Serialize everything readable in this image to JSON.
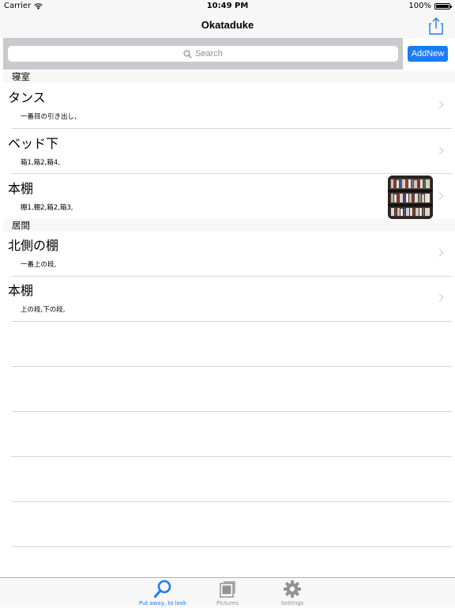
{
  "status": {
    "carrier": "Carrier",
    "time": "10:49 PM",
    "battery": "100%"
  },
  "nav": {
    "title": "Okataduke",
    "share_icon": "share-icon"
  },
  "search": {
    "placeholder": "Search",
    "add_label": "AddNew"
  },
  "sections": [
    {
      "header": "寝室",
      "rows": [
        {
          "title": "タンス",
          "subtitle": "一番目の引き出し,"
        },
        {
          "title": "ベッド下",
          "subtitle": "箱1,箱2,箱4,"
        },
        {
          "title": "本棚",
          "subtitle": "棚1,棚2,箱2,箱3,"
        }
      ]
    },
    {
      "header": "居間",
      "rows": [
        {
          "title": "北側の棚",
          "subtitle": "一番上の段,"
        },
        {
          "title": "本棚",
          "subtitle": "上の段,下の段,"
        }
      ]
    }
  ],
  "tabs": [
    {
      "label": "Put away, to look",
      "icon": "search-icon",
      "active": true
    },
    {
      "label": "Pictures",
      "icon": "pictures-icon",
      "active": false
    },
    {
      "label": "Settings",
      "icon": "gear-icon",
      "active": false
    }
  ],
  "colors": {
    "accent": "#1c7cf3",
    "tab_inactive": "#929292",
    "search_bar": "#c9c9ce"
  }
}
